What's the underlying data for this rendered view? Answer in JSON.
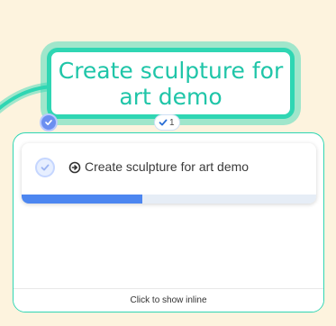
{
  "node": {
    "title": "Create sculpture for art demo",
    "completed": true
  },
  "badge": {
    "count": "1",
    "icon": "checkmark-icon"
  },
  "panel": {
    "task": {
      "text": "Create sculpture for art demo",
      "type_icon": "task-link-icon",
      "completed": true,
      "progress": 0.41
    },
    "footer_label": "Click to show inline"
  },
  "colors": {
    "background": "#fdf3de",
    "node_border": "#2fd6b3",
    "node_text": "#1fc5a8",
    "progress": "#4c86f0"
  }
}
